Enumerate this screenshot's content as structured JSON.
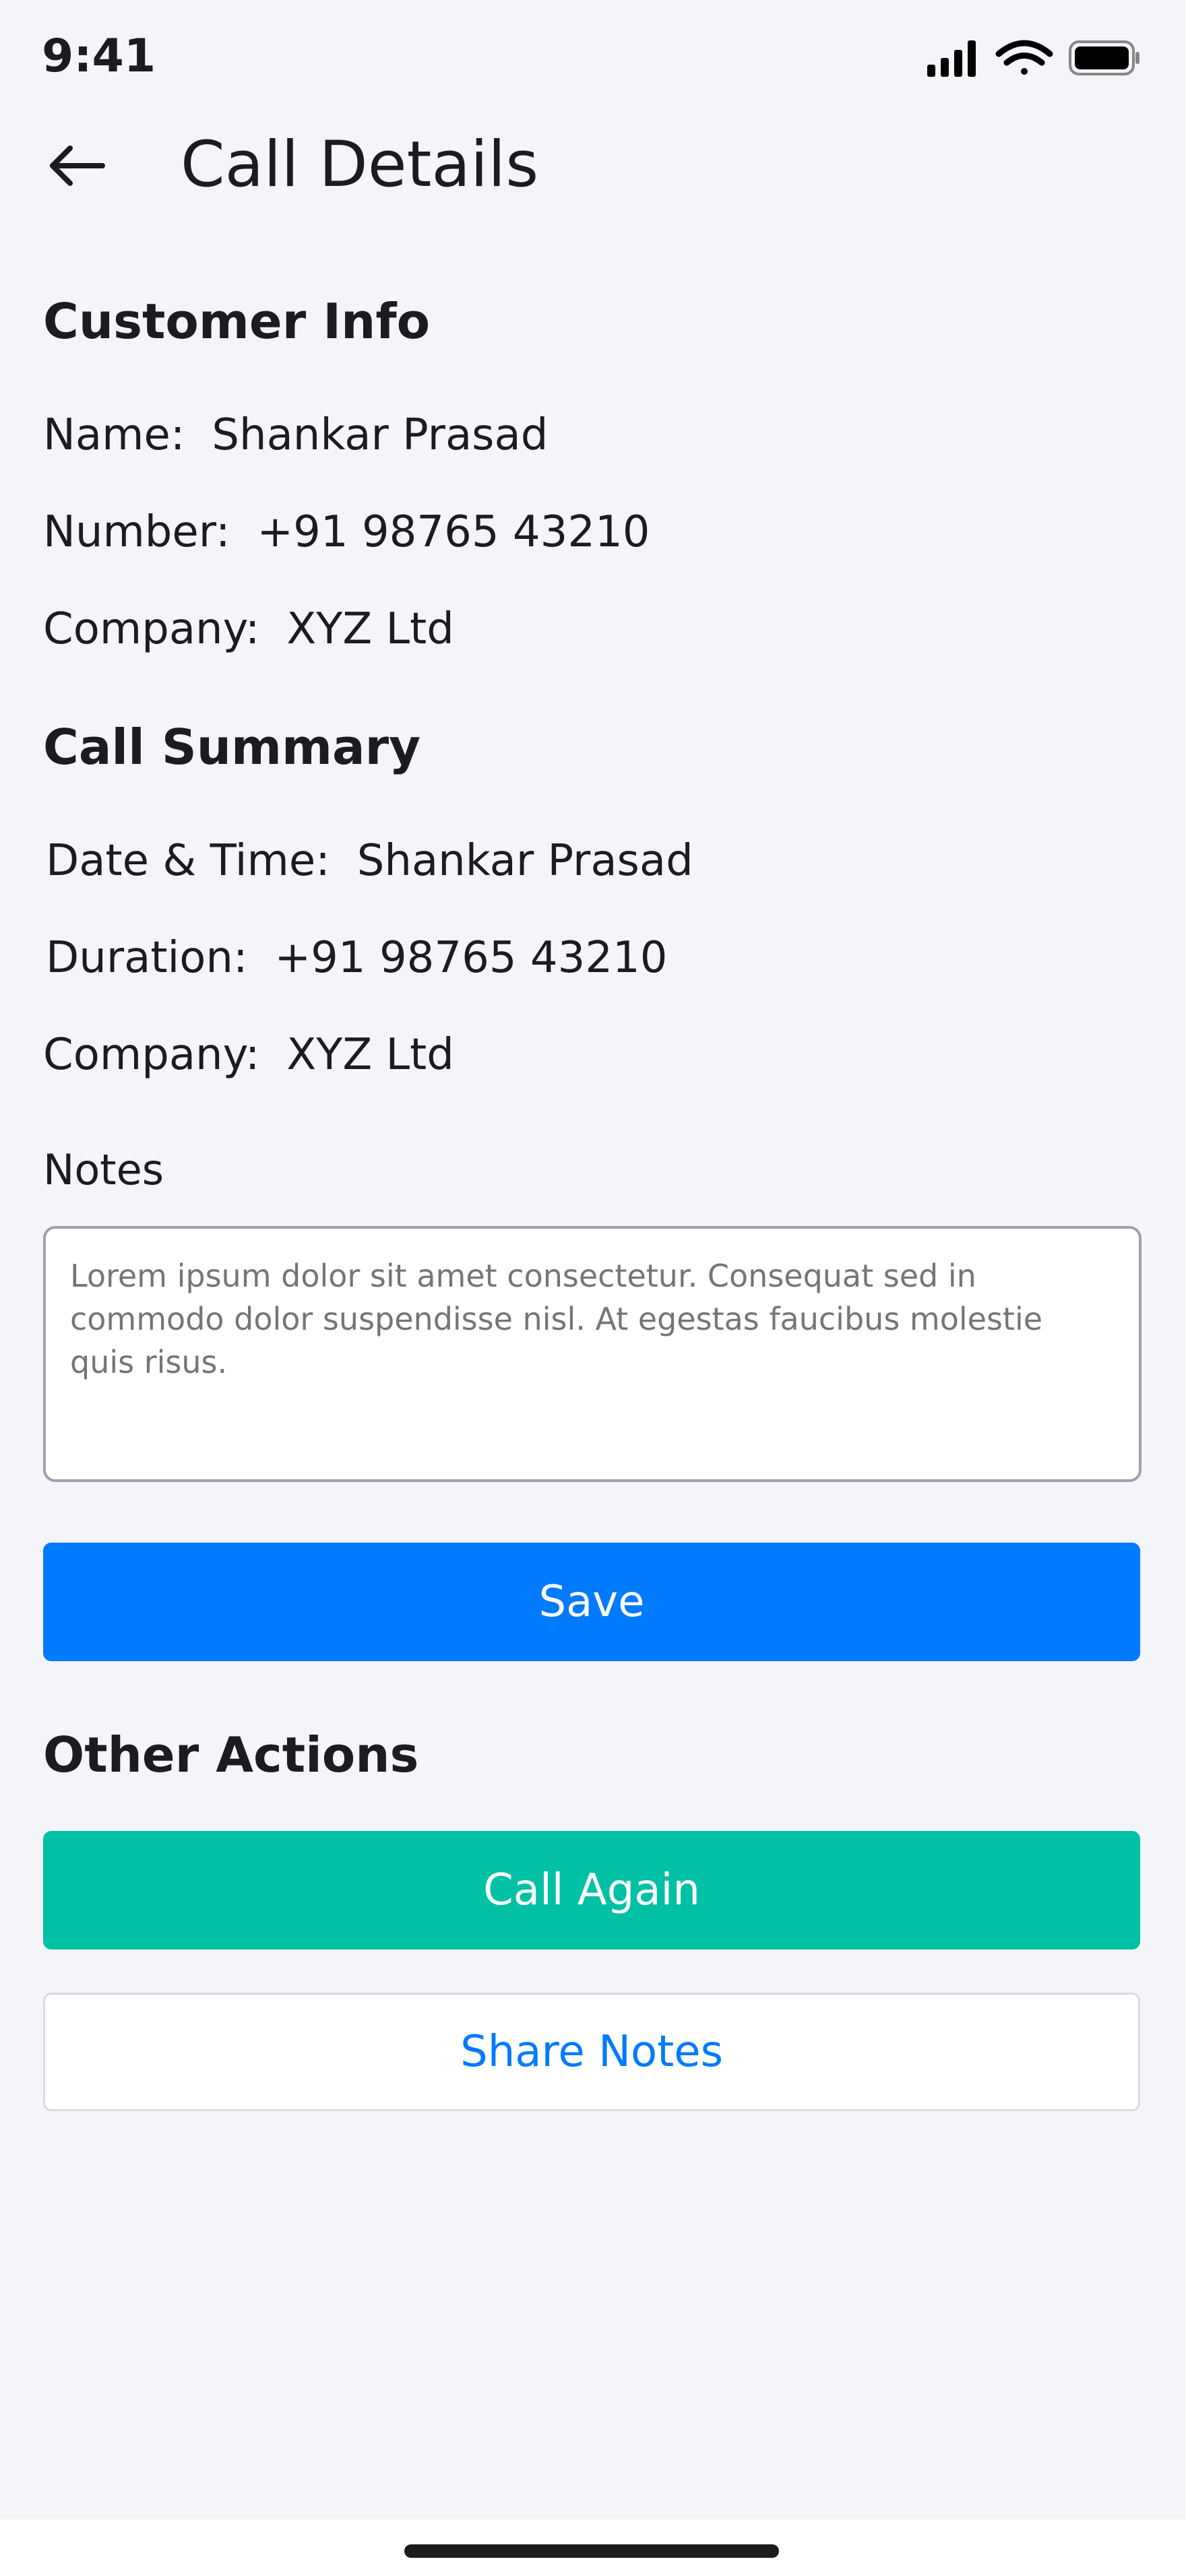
{
  "status_bar": {
    "time": "9:41"
  },
  "header": {
    "back_icon": "arrow-left-icon",
    "title": "Call Details"
  },
  "customer_info": {
    "heading": "Customer Info",
    "rows": [
      {
        "label": "Name:",
        "value": "Shankar Prasad"
      },
      {
        "label": "Number:",
        "value": "+91 98765 43210"
      },
      {
        "label": "Company:",
        "value": "XYZ Ltd"
      }
    ]
  },
  "call_summary": {
    "heading": "Call Summary",
    "rows": [
      {
        "label": "Date & Time:",
        "value": "Shankar Prasad"
      },
      {
        "label": "Duration:",
        "value": "+91 98765 43210"
      },
      {
        "label": "Company:",
        "value": "XYZ Ltd"
      }
    ]
  },
  "notes": {
    "label": "Notes",
    "placeholder": "Lorem ipsum dolor sit amet consectetur. Consequat sed in commodo dolor suspendisse nisl. At egestas faucibus molestie quis risus."
  },
  "save_button": {
    "label": "Save"
  },
  "other_actions": {
    "heading": "Other Actions",
    "call_again_label": "Call Again",
    "share_notes_label": "Share Notes"
  },
  "colors": {
    "background": "#f4f5f9",
    "primary_blue": "#007aff",
    "teal": "#00c1a6",
    "text": "#1c1c1e",
    "placeholder": "#8e8e93"
  }
}
